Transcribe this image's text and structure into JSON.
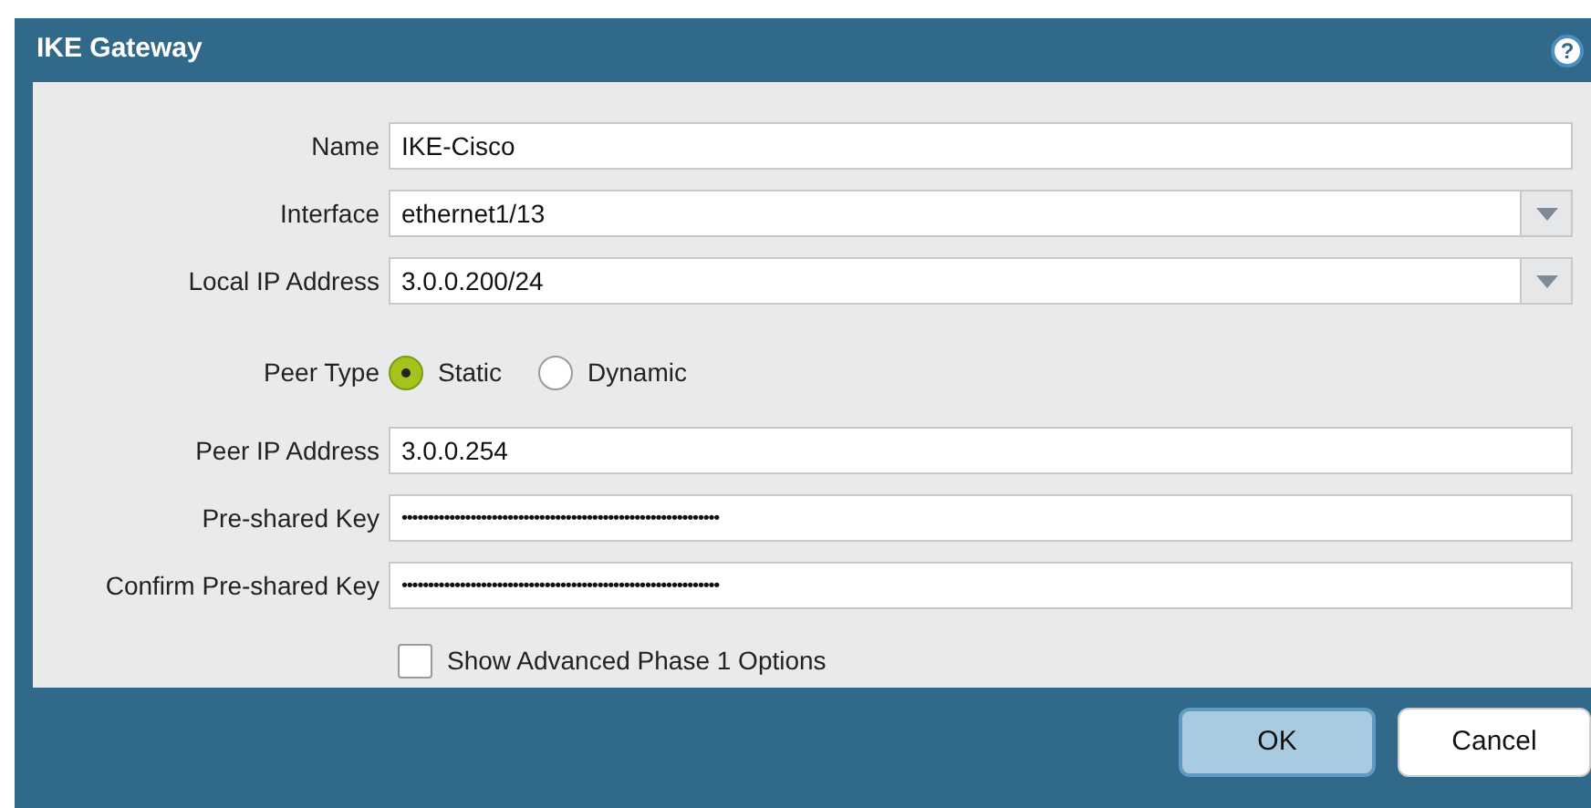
{
  "window": {
    "title": "IKE Gateway",
    "help_icon": "?"
  },
  "fields": [
    {
      "kind": "text",
      "label": "Name",
      "value": "IKE-Cisco"
    },
    {
      "kind": "select",
      "label": "Interface",
      "value": "ethernet1/13"
    },
    {
      "kind": "select",
      "label": "Local IP Address",
      "value": "3.0.0.200/24"
    },
    {
      "kind": "radio",
      "label": "Peer Type",
      "options": [
        {
          "label": "Static",
          "selected": true
        },
        {
          "label": "Dynamic",
          "selected": false
        }
      ]
    },
    {
      "kind": "text",
      "label": "Peer IP Address",
      "value": "3.0.0.254"
    },
    {
      "kind": "text",
      "label": "Pre-shared Key",
      "value": "••••••••••••••••••••••••••••••••••••••••••••••••••••••••••••"
    },
    {
      "kind": "text",
      "label": "Confirm Pre-shared Key",
      "value": "••••••••••••••••••••••••••••••••••••••••••••••••••••••••••••"
    }
  ],
  "advanced": {
    "label": "Show Advanced Phase 1 Options",
    "checked": false
  },
  "buttons": [
    {
      "label": "OK",
      "kind": "primary"
    },
    {
      "label": "Cancel",
      "kind": "secondary"
    }
  ]
}
